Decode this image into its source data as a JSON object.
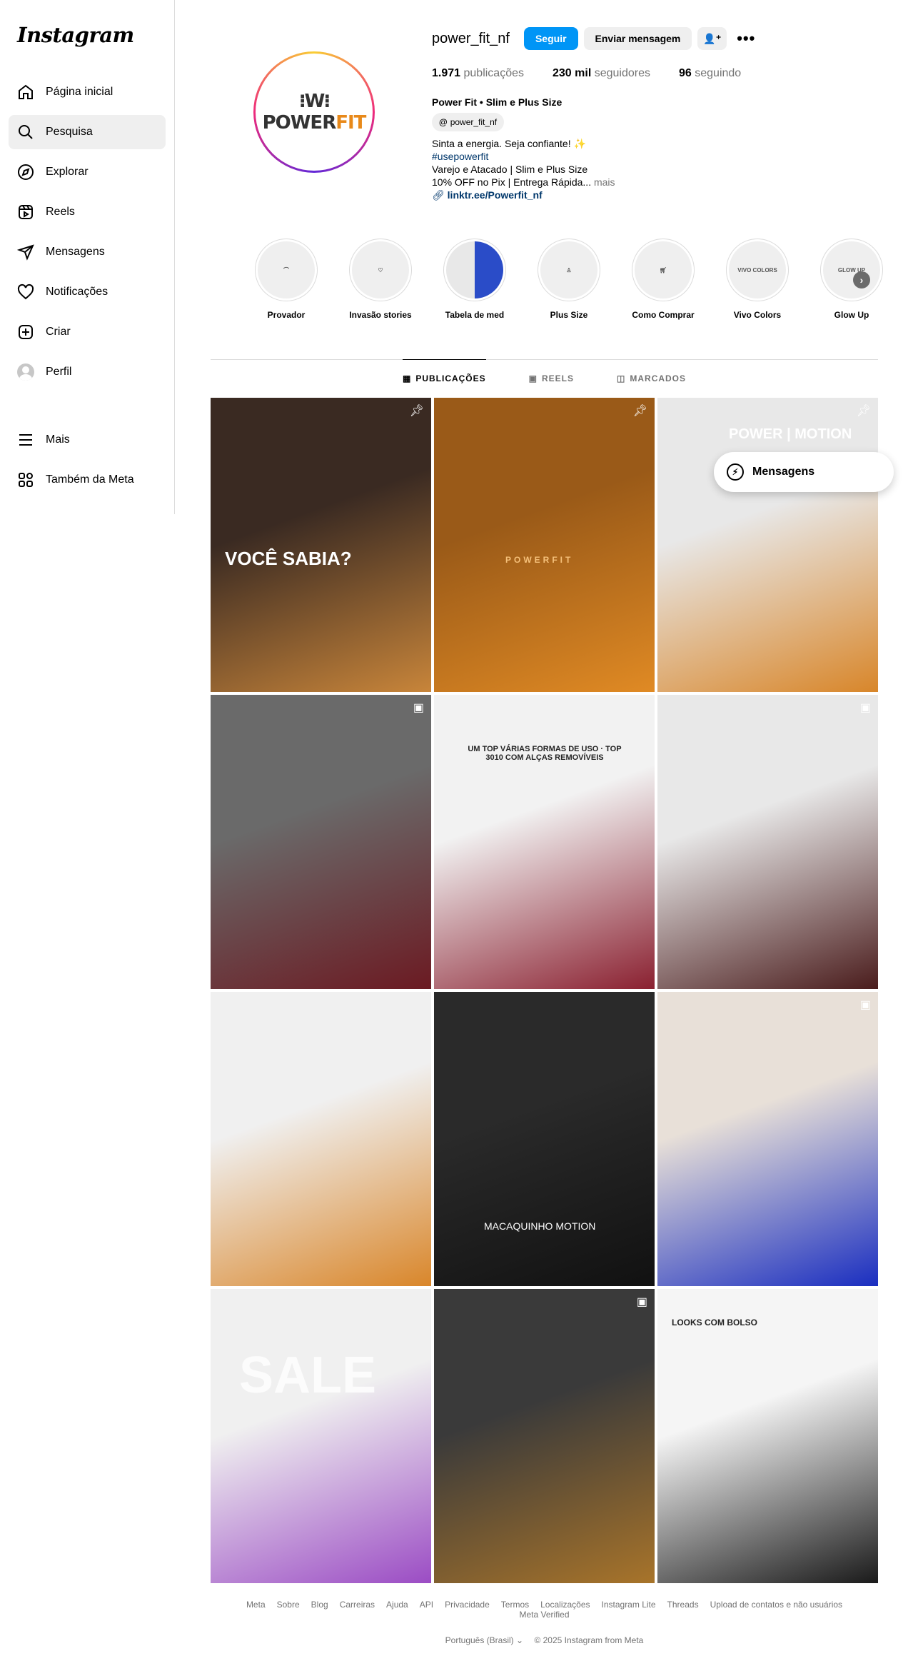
{
  "app": {
    "logo": "Instagram"
  },
  "sidebar": {
    "items": [
      {
        "label": "Página inicial",
        "icon": "home-icon"
      },
      {
        "label": "Pesquisa",
        "icon": "search-icon"
      },
      {
        "label": "Explorar",
        "icon": "compass-icon"
      },
      {
        "label": "Reels",
        "icon": "reels-icon"
      },
      {
        "label": "Mensagens",
        "icon": "messenger-icon"
      },
      {
        "label": "Notificações",
        "icon": "heart-icon"
      },
      {
        "label": "Criar",
        "icon": "plus-icon"
      },
      {
        "label": "Perfil",
        "icon": "avatar-icon"
      }
    ],
    "bottom": [
      {
        "label": "Mais",
        "icon": "menu-icon"
      },
      {
        "label": "Também da Meta",
        "icon": "meta-apps-icon"
      }
    ]
  },
  "profile": {
    "username": "power_fit_nf",
    "follow_label": "Seguir",
    "message_label": "Enviar mensagem",
    "avatar_brand": "POWERFIT",
    "stats": {
      "posts_num": "1.971",
      "posts_label": "publicações",
      "followers_num": "230 mil",
      "followers_label": "seguidores",
      "following_num": "96",
      "following_label": "seguindo"
    },
    "name": "Power Fit • Slim e Plus Size",
    "threads_handle": "power_fit_nf",
    "bio_line1": "Sinta a energia. Seja confiante! ✨",
    "bio_tag": "#usepowerfit",
    "bio_line2": "Varejo e Atacado | Slim e Plus Size",
    "bio_line3": "10% OFF no Pix | Entrega Rápida...",
    "bio_more": "mais",
    "link": "linktr.ee/Powerfit_nf"
  },
  "highlights": [
    {
      "label": "Provador",
      "inner": ""
    },
    {
      "label": "Invasão stories",
      "inner": ""
    },
    {
      "label": "Tabela de med",
      "inner": ""
    },
    {
      "label": "Plus Size",
      "inner": ""
    },
    {
      "label": "Como Comprar",
      "inner": ""
    },
    {
      "label": "Vivo Colors",
      "inner": "VIVO COLORS"
    },
    {
      "label": "Glow Up",
      "inner": "GLOW UP"
    }
  ],
  "tabs": [
    {
      "label": "PUBLICAÇÕES"
    },
    {
      "label": "REELS"
    },
    {
      "label": "MARCADOS"
    }
  ],
  "posts": [
    {
      "title": "VOCÊ SABIA?",
      "colors": [
        "#3a2a22",
        "#c8853a"
      ]
    },
    {
      "title": "POWERFIT",
      "colors": [
        "#9a5a18",
        "#e08a24"
      ]
    },
    {
      "title": "POWER | MOTION",
      "colors": [
        "#e8e8e8",
        "#d8862a"
      ]
    },
    {
      "title": "",
      "colors": [
        "#6a6a6a",
        "#6b1a22"
      ]
    },
    {
      "title": "UM TOP VÁRIAS FORMAS DE USO · TOP 3010 COM ALÇAS REMOVÍVEIS",
      "colors": [
        "#f2f2f2",
        "#8a2030"
      ]
    },
    {
      "title": "",
      "colors": [
        "#e8e8e8",
        "#4a1c1c"
      ]
    },
    {
      "title": "",
      "colors": [
        "#f0f0f0",
        "#d9862a"
      ]
    },
    {
      "title": "MACAQUINHO MOTION",
      "colors": [
        "#2a2a2a",
        "#111111"
      ]
    },
    {
      "title": "",
      "colors": [
        "#e8e0d8",
        "#1a2ec0"
      ]
    },
    {
      "title": "SALE",
      "colors": [
        "#f0f0f0",
        "#9b4cc4"
      ]
    },
    {
      "title": "",
      "colors": [
        "#3a3a3a",
        "#a8742a"
      ]
    },
    {
      "title": "LOOKS COM BOLSO",
      "colors": [
        "#f5f5f5",
        "#1a1a1a"
      ]
    }
  ],
  "messages_bar": {
    "label": "Mensagens"
  },
  "footer": {
    "links": [
      "Meta",
      "Sobre",
      "Blog",
      "Carreiras",
      "Ajuda",
      "API",
      "Privacidade",
      "Termos",
      "Localizações",
      "Instagram Lite",
      "Threads",
      "Upload de contatos e não usuários",
      "Meta Verified"
    ],
    "language": "Português (Brasil)",
    "copyright": "© 2025 Instagram from Meta"
  }
}
